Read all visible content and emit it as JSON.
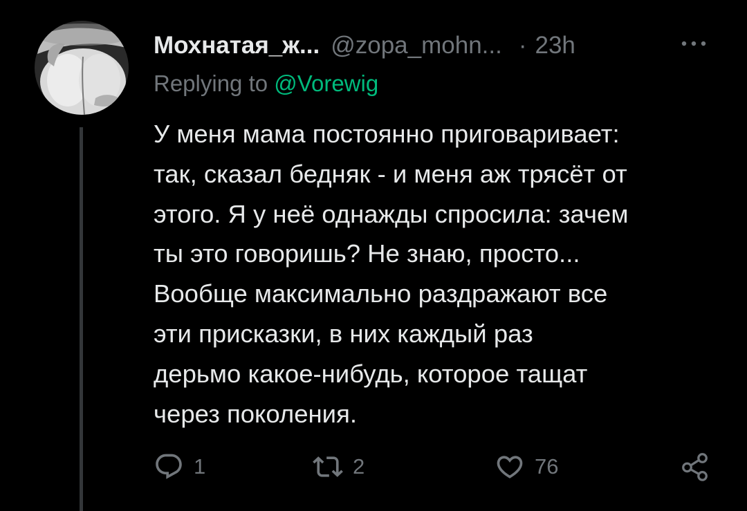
{
  "tweet": {
    "author_name": "Мохнатая_ж...",
    "author_handle": "@zopa_mohn...",
    "separator": "·",
    "time": "23h",
    "replying_prefix": "Replying to",
    "replying_to": "@Vorewig",
    "text": "У меня мама постоянно приговаривает:\nтак, сказал бедняк - и меня аж трясёт от\nэтого. Я у неё однажды спросила: зачем\nты это говоришь? Не знаю, просто...\nВообще максимально раздражают все\nэти присказки, в них каждый раз\nдерьмо какое-нибудь, которое тащат\nчерез поколения."
  },
  "actions": {
    "replies": "1",
    "retweets": "2",
    "likes": "76"
  },
  "icons": {
    "more": "more-horizontal-icon",
    "reply": "reply-bubble-icon",
    "retweet": "retweet-icon",
    "like": "heart-icon",
    "share": "share-icon"
  },
  "colors": {
    "background": "#000000",
    "text_primary": "#e7e9ea",
    "text_secondary": "#71767b",
    "mention": "#00ba7c"
  }
}
